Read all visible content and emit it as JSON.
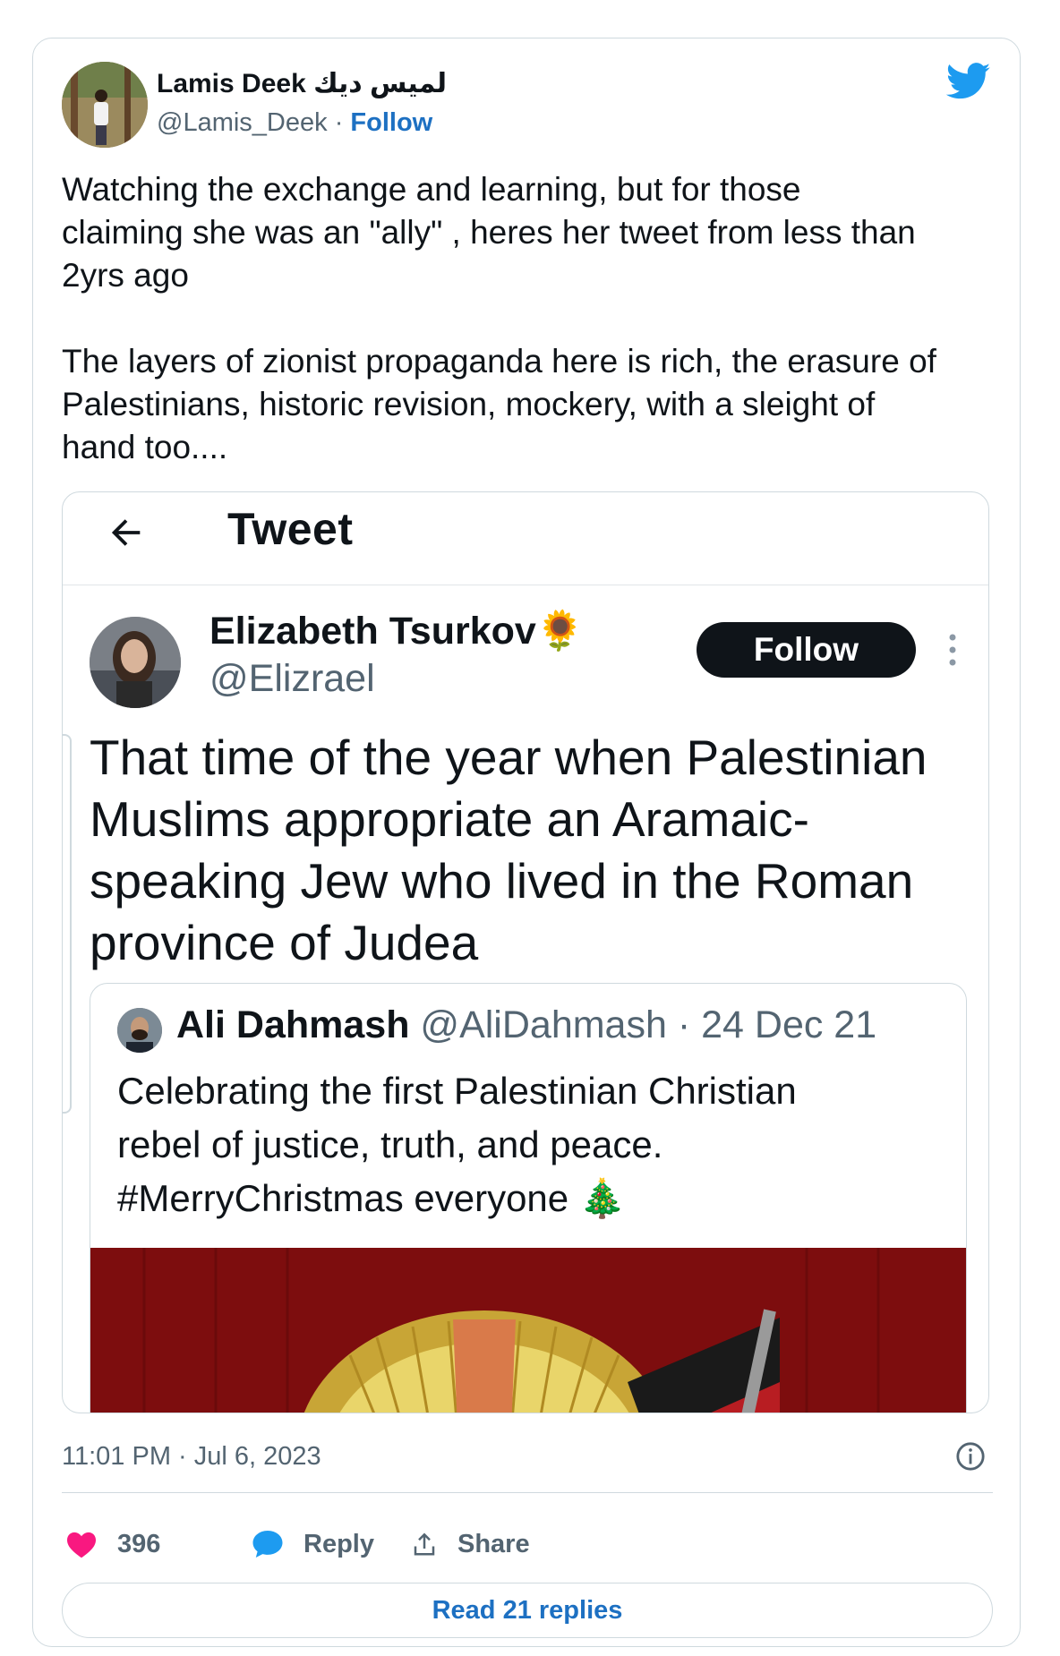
{
  "author": {
    "name": "Lamis Deek لميس ديك",
    "handle": "@Lamis_Deek",
    "separator": "·",
    "follow_label": "Follow"
  },
  "tweet": {
    "paragraph1": "Watching the exchange and learning, but for those\nclaiming she was an \"ally\" , heres her tweet from less than\n2yrs ago",
    "paragraph2": "The layers of zionist propaganda here is rich, the erasure of\nPalestinians, historic revision, mockery, with a sleight of\nhand too...."
  },
  "embedded_screenshot": {
    "header_title": "Tweet",
    "author_name": "Elizabeth Tsurkov🌻",
    "author_handle": "@Elizrael",
    "follow_label": "Follow",
    "text": "That time of the year when Palestinian Muslims appropriate an Aramaic-speaking Jew who lived in the Roman province of Judea",
    "quoted": {
      "name": "Ali Dahmash",
      "handle": "@AliDahmash",
      "date": "· 24 Dec 21",
      "text": "Celebrating the first Palestinian Christian\nrebel of justice, truth, and peace.\n#MerryChristmas everyone 🎄"
    }
  },
  "footer": {
    "timestamp": "11:01 PM · Jul 6, 2023",
    "likes": "396",
    "reply_label": "Reply",
    "share_label": "Share",
    "read_replies_label": "Read 21 replies"
  },
  "colors": {
    "link_blue": "#1d70c2",
    "twitter_blue": "#1d9bf0",
    "heart_pink": "#f91880",
    "muted_text": "#536471",
    "border": "#cfd9de"
  },
  "icons": [
    "twitter-bird-icon",
    "back-arrow-icon",
    "more-vertical-icon",
    "info-icon",
    "heart-icon",
    "reply-bubble-icon",
    "share-upload-icon"
  ]
}
